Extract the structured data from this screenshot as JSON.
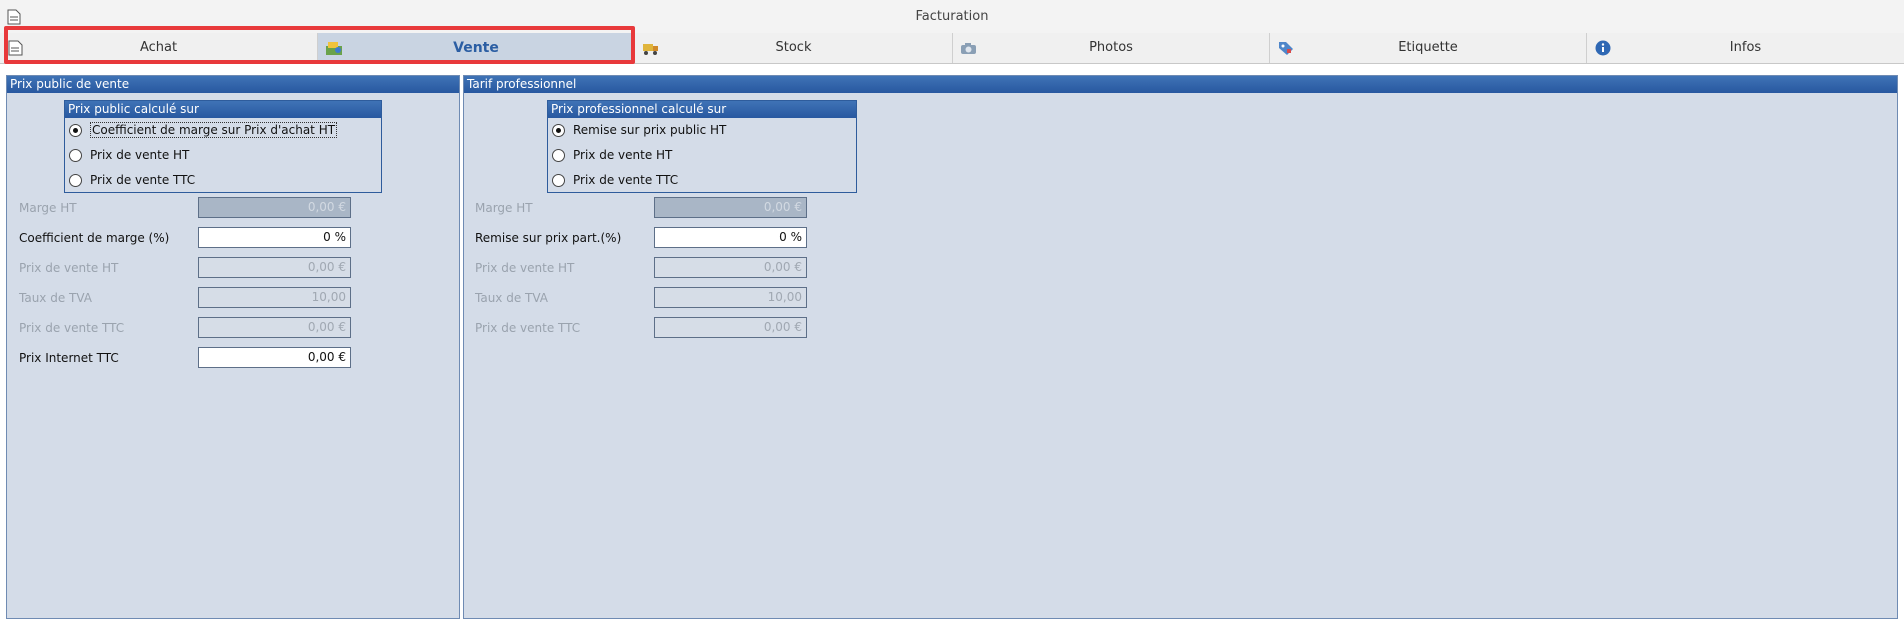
{
  "window": {
    "title": "Facturation"
  },
  "tabs": [
    {
      "label": "Achat",
      "icon": "document-icon"
    },
    {
      "label": "Vente",
      "icon": "price-tag-icon",
      "active": true
    },
    {
      "label": "Stock",
      "icon": "truck-icon"
    },
    {
      "label": "Photos",
      "icon": "camera-icon"
    },
    {
      "label": "Etiquette",
      "icon": "label-icon"
    },
    {
      "label": "Infos",
      "icon": "info-icon"
    }
  ],
  "left_panel": {
    "title": "Prix public de vente",
    "group_title": "Prix public calculé sur",
    "options": [
      {
        "label": "Coefficient de marge sur Prix d'achat HT",
        "checked": true
      },
      {
        "label": "Prix de vente HT",
        "checked": false
      },
      {
        "label": "Prix de vente TTC",
        "checked": false
      }
    ],
    "fields": [
      {
        "label": "Marge HT",
        "value": "0,00 €"
      },
      {
        "label": "Coefficient de marge (%)",
        "value": "0 %"
      },
      {
        "label": "Prix de vente HT",
        "value": "0,00 €"
      },
      {
        "label": "Taux de TVA",
        "value": "10,00"
      },
      {
        "label": "Prix de vente TTC",
        "value": "0,00 €"
      },
      {
        "label": "Prix Internet TTC",
        "value": "0,00 €"
      }
    ]
  },
  "right_panel": {
    "title": "Tarif professionnel",
    "group_title": "Prix professionnel calculé sur",
    "options": [
      {
        "label": "Remise sur prix public HT",
        "checked": true
      },
      {
        "label": "Prix de vente HT",
        "checked": false
      },
      {
        "label": "Prix de vente TTC",
        "checked": false
      }
    ],
    "fields": [
      {
        "label": "Marge HT",
        "value": "0,00 €"
      },
      {
        "label": "Remise sur prix part.(%)",
        "value": "0 %"
      },
      {
        "label": "Prix de vente HT",
        "value": "0,00 €"
      },
      {
        "label": "Taux de TVA",
        "value": "10,00"
      },
      {
        "label": "Prix de vente TTC",
        "value": "0,00 €"
      }
    ]
  },
  "colors": {
    "highlight": "#e8393b",
    "panel_header": "#2858a0",
    "panel_background": "#d4dce8",
    "active_tab_text": "#2b5ea3"
  }
}
